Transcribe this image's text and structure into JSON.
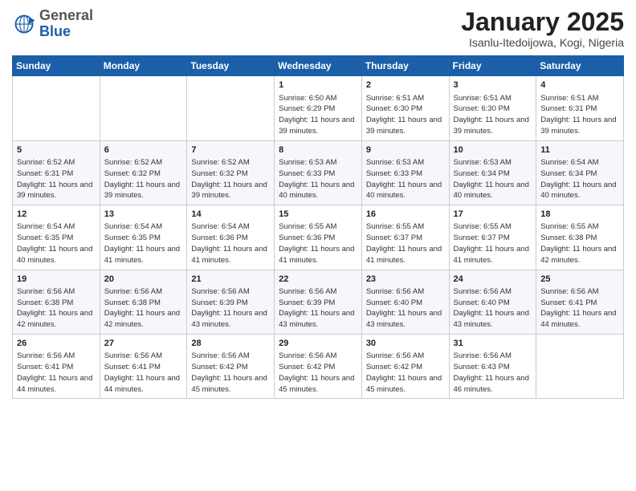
{
  "logo": {
    "general": "General",
    "blue": "Blue"
  },
  "header": {
    "title": "January 2025",
    "subtitle": "Isanlu-Itedoijowa, Kogi, Nigeria"
  },
  "weekdays": [
    "Sunday",
    "Monday",
    "Tuesday",
    "Wednesday",
    "Thursday",
    "Friday",
    "Saturday"
  ],
  "weeks": [
    [
      {
        "day": "",
        "info": ""
      },
      {
        "day": "",
        "info": ""
      },
      {
        "day": "",
        "info": ""
      },
      {
        "day": "1",
        "info": "Sunrise: 6:50 AM\nSunset: 6:29 PM\nDaylight: 11 hours and 39 minutes."
      },
      {
        "day": "2",
        "info": "Sunrise: 6:51 AM\nSunset: 6:30 PM\nDaylight: 11 hours and 39 minutes."
      },
      {
        "day": "3",
        "info": "Sunrise: 6:51 AM\nSunset: 6:30 PM\nDaylight: 11 hours and 39 minutes."
      },
      {
        "day": "4",
        "info": "Sunrise: 6:51 AM\nSunset: 6:31 PM\nDaylight: 11 hours and 39 minutes."
      }
    ],
    [
      {
        "day": "5",
        "info": "Sunrise: 6:52 AM\nSunset: 6:31 PM\nDaylight: 11 hours and 39 minutes."
      },
      {
        "day": "6",
        "info": "Sunrise: 6:52 AM\nSunset: 6:32 PM\nDaylight: 11 hours and 39 minutes."
      },
      {
        "day": "7",
        "info": "Sunrise: 6:52 AM\nSunset: 6:32 PM\nDaylight: 11 hours and 39 minutes."
      },
      {
        "day": "8",
        "info": "Sunrise: 6:53 AM\nSunset: 6:33 PM\nDaylight: 11 hours and 40 minutes."
      },
      {
        "day": "9",
        "info": "Sunrise: 6:53 AM\nSunset: 6:33 PM\nDaylight: 11 hours and 40 minutes."
      },
      {
        "day": "10",
        "info": "Sunrise: 6:53 AM\nSunset: 6:34 PM\nDaylight: 11 hours and 40 minutes."
      },
      {
        "day": "11",
        "info": "Sunrise: 6:54 AM\nSunset: 6:34 PM\nDaylight: 11 hours and 40 minutes."
      }
    ],
    [
      {
        "day": "12",
        "info": "Sunrise: 6:54 AM\nSunset: 6:35 PM\nDaylight: 11 hours and 40 minutes."
      },
      {
        "day": "13",
        "info": "Sunrise: 6:54 AM\nSunset: 6:35 PM\nDaylight: 11 hours and 41 minutes."
      },
      {
        "day": "14",
        "info": "Sunrise: 6:54 AM\nSunset: 6:36 PM\nDaylight: 11 hours and 41 minutes."
      },
      {
        "day": "15",
        "info": "Sunrise: 6:55 AM\nSunset: 6:36 PM\nDaylight: 11 hours and 41 minutes."
      },
      {
        "day": "16",
        "info": "Sunrise: 6:55 AM\nSunset: 6:37 PM\nDaylight: 11 hours and 41 minutes."
      },
      {
        "day": "17",
        "info": "Sunrise: 6:55 AM\nSunset: 6:37 PM\nDaylight: 11 hours and 41 minutes."
      },
      {
        "day": "18",
        "info": "Sunrise: 6:55 AM\nSunset: 6:38 PM\nDaylight: 11 hours and 42 minutes."
      }
    ],
    [
      {
        "day": "19",
        "info": "Sunrise: 6:56 AM\nSunset: 6:38 PM\nDaylight: 11 hours and 42 minutes."
      },
      {
        "day": "20",
        "info": "Sunrise: 6:56 AM\nSunset: 6:38 PM\nDaylight: 11 hours and 42 minutes."
      },
      {
        "day": "21",
        "info": "Sunrise: 6:56 AM\nSunset: 6:39 PM\nDaylight: 11 hours and 43 minutes."
      },
      {
        "day": "22",
        "info": "Sunrise: 6:56 AM\nSunset: 6:39 PM\nDaylight: 11 hours and 43 minutes."
      },
      {
        "day": "23",
        "info": "Sunrise: 6:56 AM\nSunset: 6:40 PM\nDaylight: 11 hours and 43 minutes."
      },
      {
        "day": "24",
        "info": "Sunrise: 6:56 AM\nSunset: 6:40 PM\nDaylight: 11 hours and 43 minutes."
      },
      {
        "day": "25",
        "info": "Sunrise: 6:56 AM\nSunset: 6:41 PM\nDaylight: 11 hours and 44 minutes."
      }
    ],
    [
      {
        "day": "26",
        "info": "Sunrise: 6:56 AM\nSunset: 6:41 PM\nDaylight: 11 hours and 44 minutes."
      },
      {
        "day": "27",
        "info": "Sunrise: 6:56 AM\nSunset: 6:41 PM\nDaylight: 11 hours and 44 minutes."
      },
      {
        "day": "28",
        "info": "Sunrise: 6:56 AM\nSunset: 6:42 PM\nDaylight: 11 hours and 45 minutes."
      },
      {
        "day": "29",
        "info": "Sunrise: 6:56 AM\nSunset: 6:42 PM\nDaylight: 11 hours and 45 minutes."
      },
      {
        "day": "30",
        "info": "Sunrise: 6:56 AM\nSunset: 6:42 PM\nDaylight: 11 hours and 45 minutes."
      },
      {
        "day": "31",
        "info": "Sunrise: 6:56 AM\nSunset: 6:43 PM\nDaylight: 11 hours and 46 minutes."
      },
      {
        "day": "",
        "info": ""
      }
    ]
  ]
}
